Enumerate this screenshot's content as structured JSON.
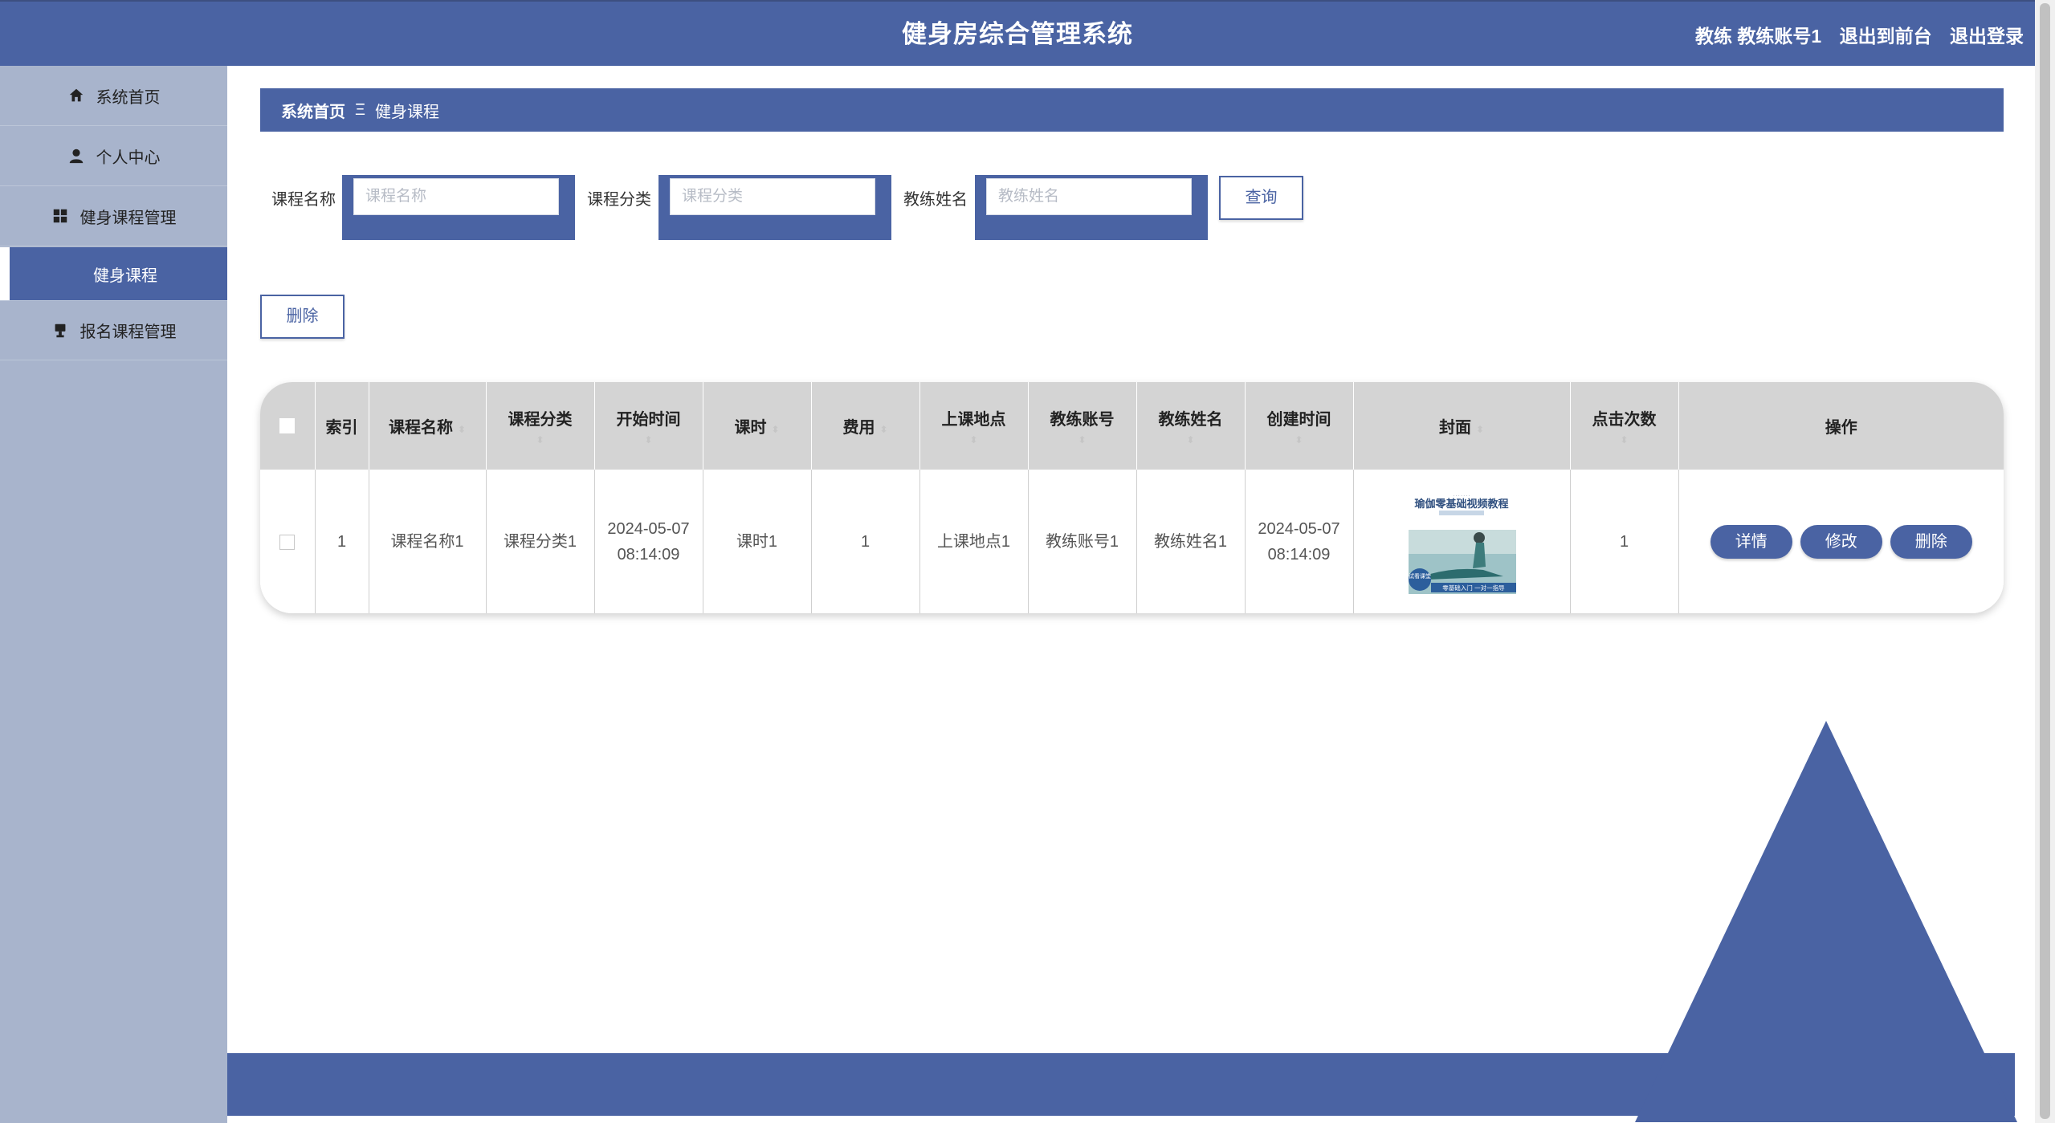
{
  "header": {
    "title": "健身房综合管理系统",
    "user_label": "教练 教练账号1",
    "back_to_front": "退出到前台",
    "logout": "退出登录"
  },
  "sidebar": {
    "items": [
      {
        "label": "系统首页",
        "icon": "home-icon"
      },
      {
        "label": "个人中心",
        "icon": "user-icon"
      },
      {
        "label": "健身课程管理",
        "icon": "grid-icon"
      },
      {
        "label": "健身课程",
        "icon": null,
        "active": true
      },
      {
        "label": "报名课程管理",
        "icon": "stamp-icon"
      }
    ]
  },
  "breadcrumb": {
    "home": "系统首页",
    "separator": "Ξ",
    "current": "健身课程"
  },
  "search": {
    "name_label": "课程名称",
    "name_placeholder": "课程名称",
    "category_label": "课程分类",
    "category_placeholder": "课程分类",
    "coach_label": "教练姓名",
    "coach_placeholder": "教练姓名",
    "query_button": "查询"
  },
  "actions": {
    "delete_button": "删除"
  },
  "table": {
    "columns": [
      "索引",
      "课程名称",
      "课程分类",
      "开始时间",
      "课时",
      "费用",
      "上课地点",
      "教练账号",
      "教练姓名",
      "创建时间",
      "封面",
      "点击次数",
      "操作"
    ],
    "rows": [
      {
        "index": "1",
        "name": "课程名称1",
        "category": "课程分类1",
        "start_date": "2024-05-07",
        "start_time": "08:14:09",
        "period": "课时1",
        "fee": "1",
        "location": "上课地点1",
        "coach_account": "教练账号1",
        "coach_name": "教练姓名1",
        "created_date": "2024-05-07",
        "created_time": "08:14:09",
        "cover": {
          "title": "瑜伽零基础视频教程",
          "subtitle": "零基础入门 一对一指导",
          "badge": "试看课堂"
        },
        "clicks": "1",
        "ops": {
          "detail": "详情",
          "edit": "修改",
          "delete": "删除"
        }
      }
    ]
  },
  "colors": {
    "primary": "#4a63a3",
    "sidebar_bg": "#a8b4cc",
    "table_header": "#d4d4d4"
  }
}
